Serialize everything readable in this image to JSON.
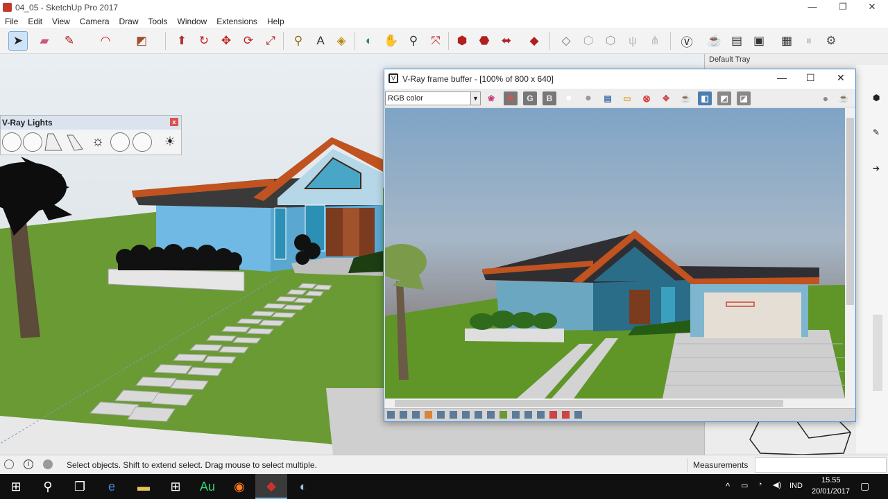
{
  "window": {
    "title": "04_05 - SketchUp Pro 2017",
    "controls": {
      "minimize": "—",
      "maximize": "❐",
      "close": "✕"
    }
  },
  "menu": [
    "File",
    "Edit",
    "View",
    "Camera",
    "Draw",
    "Tools",
    "Window",
    "Extensions",
    "Help"
  ],
  "toolbar": {
    "tools": [
      "select-icon",
      "eraser-icon",
      "pencil-icon",
      "arc-icon",
      "rectangle-icon",
      "push-pull-icon",
      "follow-me-icon",
      "move-icon",
      "rotate-icon",
      "scale-icon",
      "tape-measure-icon",
      "text-icon",
      "paint-bucket-icon",
      "orbit-icon",
      "pan-icon",
      "zoom-icon",
      "zoom-extents-icon",
      "warehouse-icon",
      "extension-warehouse-icon",
      "send-to-layout-icon",
      "ruby-icon",
      "vray-icon",
      "teapot-icon"
    ]
  },
  "lights_panel": {
    "title": "V-Ray Lights",
    "close": "x"
  },
  "vfb": {
    "title": "V-Ray frame buffer - [100% of 800 x 640]",
    "channel": "RGB color",
    "buttons": {
      "r": "R",
      "g": "G",
      "b": "B"
    }
  },
  "tray": {
    "title": "Default Tray"
  },
  "status": {
    "message": "Select objects. Shift to extend select. Drag mouse to select multiple.",
    "measurements_label": "Measurements"
  },
  "taskbar": {
    "language": "IND",
    "time": "15.55",
    "date": "20/01/2017",
    "apps": [
      "windows-start-icon",
      "search-icon",
      "task-view-icon",
      "edge-icon",
      "file-explorer-icon",
      "store-icon",
      "audition-icon",
      "firefox-icon",
      "sketchup-icon",
      "vray-app-icon"
    ]
  },
  "colors": {
    "accent": "#4a90d9",
    "taskbar": "#101010",
    "grass": "#6a9a34",
    "sky": "#8fa9c3",
    "roof_trim": "#c0531f",
    "wall_blue": "#6fb9e4"
  }
}
